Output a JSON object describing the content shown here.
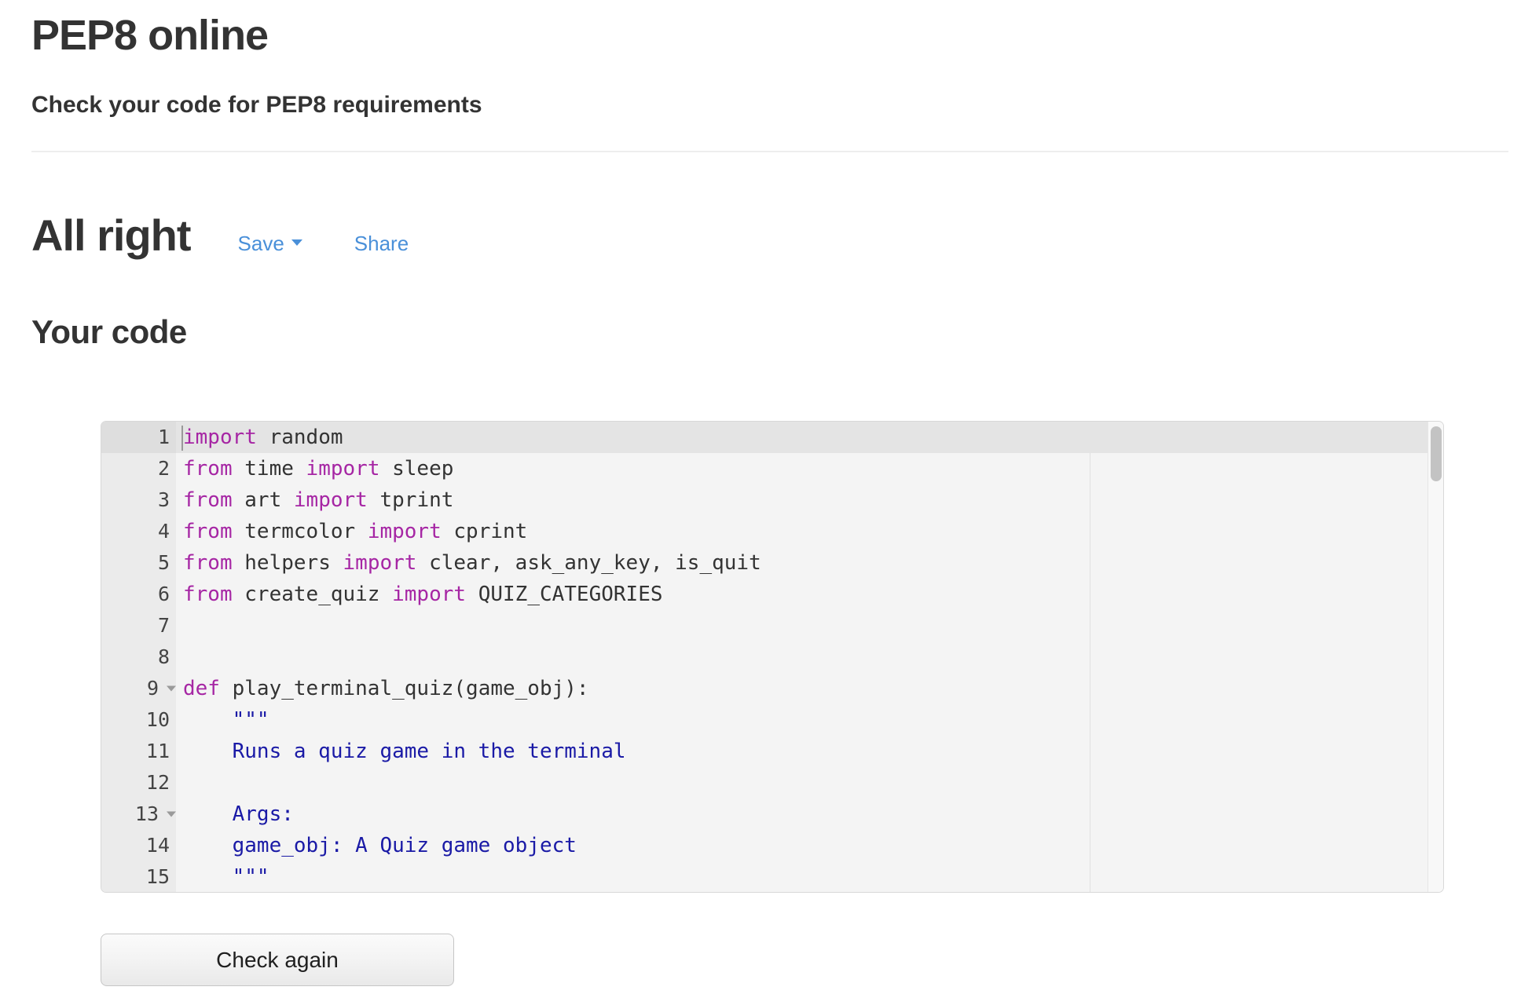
{
  "header": {
    "title": "PEP8 online",
    "subtitle": "Check your code for PEP8 requirements"
  },
  "result": {
    "status": "All right",
    "save_label": "Save",
    "share_label": "Share"
  },
  "code_section": {
    "heading": "Your code"
  },
  "editor": {
    "active_line": 1,
    "lines": [
      {
        "number": "1",
        "fold": false,
        "tokens": [
          {
            "t": "import",
            "c": "kw"
          },
          {
            "t": " random",
            "c": "plain"
          }
        ]
      },
      {
        "number": "2",
        "fold": false,
        "tokens": [
          {
            "t": "from",
            "c": "kw"
          },
          {
            "t": " time ",
            "c": "plain"
          },
          {
            "t": "import",
            "c": "kw"
          },
          {
            "t": " sleep",
            "c": "plain"
          }
        ]
      },
      {
        "number": "3",
        "fold": false,
        "tokens": [
          {
            "t": "from",
            "c": "kw"
          },
          {
            "t": " art ",
            "c": "plain"
          },
          {
            "t": "import",
            "c": "kw"
          },
          {
            "t": " tprint",
            "c": "plain"
          }
        ]
      },
      {
        "number": "4",
        "fold": false,
        "tokens": [
          {
            "t": "from",
            "c": "kw"
          },
          {
            "t": " termcolor ",
            "c": "plain"
          },
          {
            "t": "import",
            "c": "kw"
          },
          {
            "t": " cprint",
            "c": "plain"
          }
        ]
      },
      {
        "number": "5",
        "fold": false,
        "tokens": [
          {
            "t": "from",
            "c": "kw"
          },
          {
            "t": " helpers ",
            "c": "plain"
          },
          {
            "t": "import",
            "c": "kw"
          },
          {
            "t": " clear, ask_any_key, is_quit",
            "c": "plain"
          }
        ]
      },
      {
        "number": "6",
        "fold": false,
        "tokens": [
          {
            "t": "from",
            "c": "kw"
          },
          {
            "t": " create_quiz ",
            "c": "plain"
          },
          {
            "t": "import",
            "c": "kw"
          },
          {
            "t": " QUIZ_CATEGORIES",
            "c": "plain"
          }
        ]
      },
      {
        "number": "7",
        "fold": false,
        "tokens": []
      },
      {
        "number": "8",
        "fold": false,
        "tokens": []
      },
      {
        "number": "9",
        "fold": true,
        "tokens": [
          {
            "t": "def",
            "c": "kw"
          },
          {
            "t": " play_terminal_quiz(game_obj):",
            "c": "plain"
          }
        ]
      },
      {
        "number": "10",
        "fold": false,
        "tokens": [
          {
            "t": "    \"\"\"",
            "c": "str"
          }
        ]
      },
      {
        "number": "11",
        "fold": false,
        "tokens": [
          {
            "t": "    Runs a quiz game in the terminal",
            "c": "str"
          }
        ]
      },
      {
        "number": "12",
        "fold": false,
        "tokens": []
      },
      {
        "number": "13",
        "fold": true,
        "tokens": [
          {
            "t": "    Args:",
            "c": "str"
          }
        ]
      },
      {
        "number": "14",
        "fold": false,
        "tokens": [
          {
            "t": "    game_obj: A Quiz game object",
            "c": "str"
          }
        ]
      },
      {
        "number": "15",
        "fold": false,
        "tokens": [
          {
            "t": "    \"\"\"",
            "c": "str"
          }
        ]
      }
    ]
  },
  "actions": {
    "check_again_label": "Check again"
  },
  "colors": {
    "link": "#4a90d9",
    "keyword": "#a626a4",
    "string": "#1a1aa6",
    "text": "#333333",
    "editor_bg": "#f4f4f4",
    "gutter_bg": "#ebebeb",
    "active_line_bg": "#e4e4e4"
  }
}
